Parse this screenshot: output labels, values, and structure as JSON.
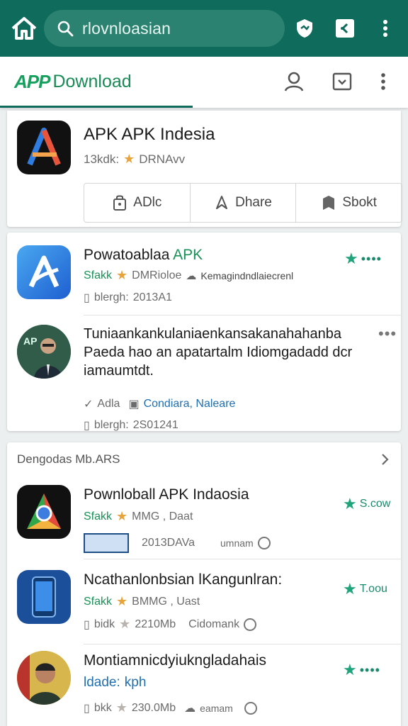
{
  "search": {
    "text": "rlovnloasian"
  },
  "appbar": {
    "brand_badge": "APP",
    "brand_text": "Download"
  },
  "featured": {
    "title": "APK APK Indesia",
    "meta": "13kdk:",
    "meta_right": "DRNAvv",
    "actions": [
      {
        "label": "ADlc",
        "icon": "install-icon"
      },
      {
        "label": "Dhare",
        "icon": "share-icon"
      },
      {
        "label": "Sbokt",
        "icon": "bookmark-icon"
      }
    ]
  },
  "list1": [
    {
      "title_a": "Powatoablaa",
      "title_b": "APK",
      "meta_a": "Sfakk",
      "meta_b": "DMRioloe",
      "meta_c": "Kemagindndlaiecrenl",
      "line2": "blergh:",
      "line2_val": "2013A1"
    },
    {
      "body": "Tuniaankankulaniaenkansakanahahanba Paeda hao an apatartalm Idiomgadadd dcr iamaumtdt.",
      "meta_a": "Adla",
      "meta_b": "Condiara, Naleare",
      "line2": "blergh:",
      "line2_val": "2S01241"
    }
  ],
  "section": {
    "header": "Dengodas Mb.ARS",
    "items": [
      {
        "title": "Pownloball APK Indaosia",
        "meta_a": "Sfakk",
        "meta_b": "MMG , Daat",
        "line2_a": "2013DAVa",
        "line2_b": "umnam",
        "badge": "S.cow"
      },
      {
        "title": "Ncathanlonbsian lKangunlran:",
        "meta_a": "Sfakk",
        "meta_b": "BMMG , Uast",
        "line2_a": "bidk",
        "line2_b": "2210Mb",
        "line2_c": "Cidomank",
        "badge": "T.oou"
      },
      {
        "title": "Montiamnicdyiukngladahais",
        "meta_a": "ldade:",
        "meta_b": "kph",
        "line2_a": "bkk",
        "line2_b": "230.0Mb",
        "line2_c": "eamam"
      }
    ]
  },
  "colors": {
    "primary": "#0f6b5c",
    "accent_green": "#1a9157",
    "star": "#e8a33a"
  }
}
